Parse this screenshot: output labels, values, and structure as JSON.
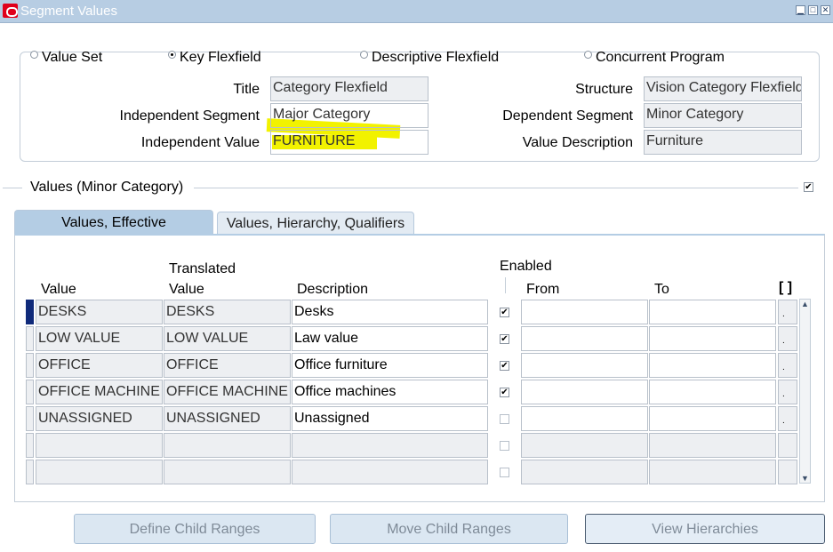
{
  "window": {
    "title": "Segment Values"
  },
  "context": {
    "options": [
      {
        "label": "Value Set",
        "selected": false
      },
      {
        "label": "Key Flexfield",
        "selected": true
      },
      {
        "label": "Descriptive Flexfield",
        "selected": false
      },
      {
        "label": "Concurrent Program",
        "selected": false
      }
    ],
    "title_label": "Title",
    "title_value": "Category Flexfield",
    "structure_label": "Structure",
    "structure_value": "Vision Category Flexfield",
    "indep_segment_label": "Independent Segment",
    "indep_segment_value": "Major Category",
    "dep_segment_label": "Dependent Segment",
    "dep_segment_value": "Minor Category",
    "indep_value_label": "Independent Value",
    "indep_value_value": "FURNITURE",
    "value_desc_label": "Value Description",
    "value_desc_value": "Furniture"
  },
  "values_section": {
    "title": "Values (Minor Category)",
    "checked": true
  },
  "tabs": [
    {
      "label": "Values, Effective",
      "active": true
    },
    {
      "label": "Values, Hierarchy, Qualifiers",
      "active": false
    }
  ],
  "columns": {
    "value": "Value",
    "translated_1": "Translated",
    "translated_2": "Value",
    "description": "Description",
    "enabled": "Enabled",
    "from": "From",
    "to": "To",
    "folder": "[ ]"
  },
  "rows": [
    {
      "value": "DESKS",
      "translated": "DESKS",
      "description": "Desks",
      "enabled": true,
      "from": "",
      "to": "",
      "current": true
    },
    {
      "value": "LOW VALUE",
      "translated": "LOW VALUE",
      "description": "Law value",
      "enabled": true,
      "from": "",
      "to": "",
      "current": false
    },
    {
      "value": "OFFICE",
      "translated": "OFFICE",
      "description": "Office furniture",
      "enabled": true,
      "from": "",
      "to": "",
      "current": false
    },
    {
      "value": "OFFICE MACHINE",
      "translated": "OFFICE MACHINE",
      "description": "Office machines",
      "enabled": true,
      "from": "",
      "to": "",
      "current": false
    },
    {
      "value": "UNASSIGNED",
      "translated": "UNASSIGNED",
      "description": "Unassigned",
      "enabled": false,
      "from": "",
      "to": "",
      "current": false
    },
    {
      "value": "",
      "translated": "",
      "description": "",
      "enabled": false,
      "from": "",
      "to": "",
      "current": false
    },
    {
      "value": "",
      "translated": "",
      "description": "",
      "enabled": false,
      "from": "",
      "to": "",
      "current": false
    }
  ],
  "buttons": {
    "define_child_ranges": "Define Child Ranges",
    "move_child_ranges": "Move Child Ranges",
    "view_hierarchies": "View Hierarchies"
  },
  "icons": {
    "app": "oracle-logo-icon",
    "minimize": "minimize-icon",
    "maximize": "maximize-icon",
    "close": "close-icon",
    "checkmark": "✔"
  },
  "colors": {
    "titlebar": "#b7cde3",
    "active_tab": "#b4cde4",
    "highlight": "#f2f200",
    "current_row_indicator": "#102a7a"
  }
}
